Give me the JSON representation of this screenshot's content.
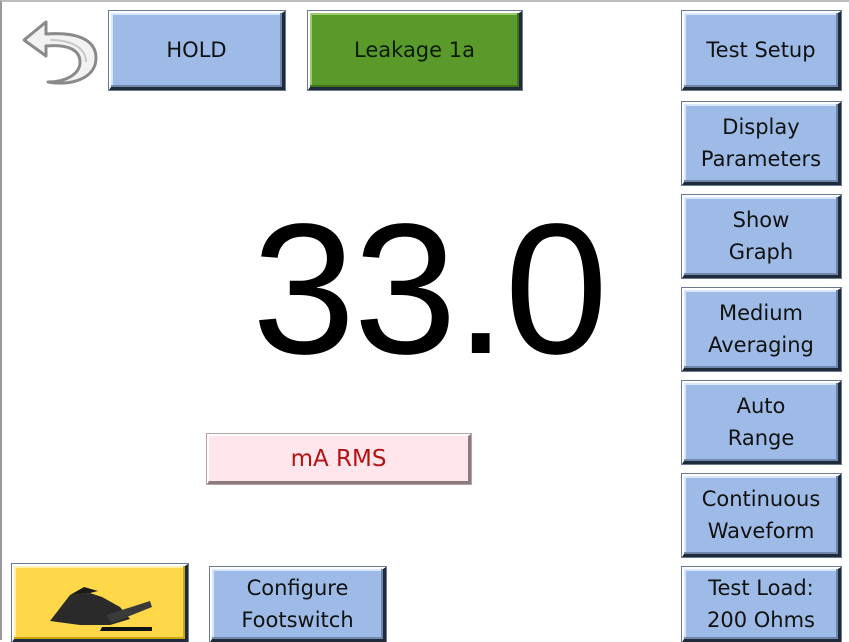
{
  "top_bar": {
    "back_icon": "back-arrow-icon",
    "hold_label": "HOLD",
    "test_name_label": "Leakage 1a"
  },
  "measurement": {
    "value": "33.0",
    "units": "mA RMS"
  },
  "side_menu": {
    "test_setup": "Test Setup",
    "display_parameters": [
      "Display",
      "Parameters"
    ],
    "show_graph": [
      "Show",
      "Graph"
    ],
    "averaging": [
      "Medium",
      "Averaging"
    ],
    "range": [
      "Auto",
      "Range"
    ],
    "waveform": [
      "Continuous",
      "Waveform"
    ],
    "test_load": [
      "Test Load:",
      "200 Ohms"
    ]
  },
  "bottom_bar": {
    "footswitch_icon": "footswitch-icon",
    "configure_footswitch": [
      "Configure",
      "Footswitch"
    ]
  },
  "colors": {
    "button_blue": "#9dbbe6",
    "test_name_green": "#5a9a2a",
    "footswitch_yellow": "#ffd84a",
    "units_background": "#ffe6ec",
    "units_text": "#b31212"
  }
}
